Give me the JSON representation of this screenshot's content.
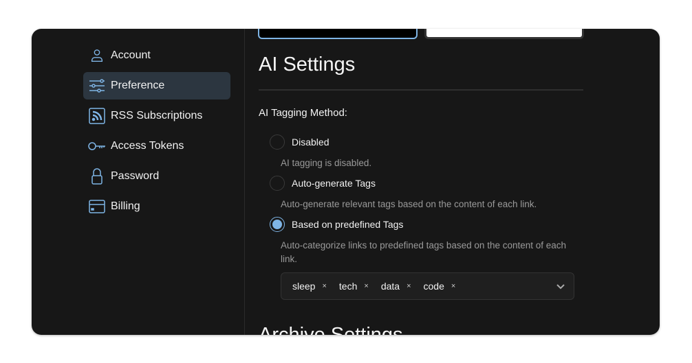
{
  "sidebar": {
    "items": [
      {
        "label": "Account",
        "icon": "user-icon",
        "active": false
      },
      {
        "label": "Preference",
        "icon": "sliders-icon",
        "active": true
      },
      {
        "label": "RSS Subscriptions",
        "icon": "rss-icon",
        "active": false
      },
      {
        "label": "Access Tokens",
        "icon": "key-icon",
        "active": false
      },
      {
        "label": "Password",
        "icon": "lock-icon",
        "active": false
      },
      {
        "label": "Billing",
        "icon": "credit-card-icon",
        "active": false
      }
    ]
  },
  "main": {
    "theme": {
      "selected": "dark"
    },
    "ai_settings": {
      "title": "AI Settings",
      "method_label": "AI Tagging Method:",
      "options": [
        {
          "label": "Disabled",
          "description": "AI tagging is disabled.",
          "checked": false
        },
        {
          "label": "Auto-generate Tags",
          "description": "Auto-generate relevant tags based on the content of each link.",
          "checked": false
        },
        {
          "label": "Based on predefined Tags",
          "description": "Auto-categorize links to predefined tags based on the content of each link.",
          "checked": true
        }
      ],
      "tags": [
        "sleep",
        "tech",
        "data",
        "code"
      ],
      "tag_remove": "×"
    },
    "archive_settings": {
      "title": "Archive Settings"
    }
  },
  "colors": {
    "accent": "#7fb5e6",
    "background": "#171717",
    "active_item": "#2c3640"
  }
}
